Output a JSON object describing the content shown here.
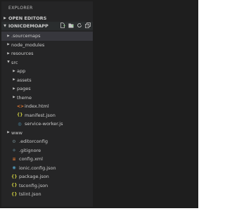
{
  "explorer": {
    "title": "EXPLORER",
    "open_editors": {
      "chevron": "▶",
      "label": "OPEN EDITORS"
    },
    "project": {
      "chevron": "▼",
      "label": "IONICDEMOAPP",
      "actions": [
        "new-file-icon",
        "new-folder-icon",
        "refresh-icon",
        "collapse-all-icon"
      ]
    }
  },
  "tree": [
    {
      "label": ".sourcemaps",
      "type": "folder",
      "expanded": false,
      "depth": 0,
      "selected": true,
      "arrow": "▶"
    },
    {
      "label": "node_modules",
      "type": "folder",
      "expanded": false,
      "depth": 0,
      "arrow": "▶"
    },
    {
      "label": "resources",
      "type": "folder",
      "expanded": false,
      "depth": 0,
      "arrow": "▶"
    },
    {
      "label": "src",
      "type": "folder",
      "expanded": true,
      "depth": 0,
      "arrow": "▼"
    },
    {
      "label": "app",
      "type": "folder",
      "expanded": false,
      "depth": 1,
      "arrow": "▶"
    },
    {
      "label": "assets",
      "type": "folder",
      "expanded": false,
      "depth": 1,
      "arrow": "▶"
    },
    {
      "label": "pages",
      "type": "folder",
      "expanded": false,
      "depth": 1,
      "arrow": "▶"
    },
    {
      "label": "theme",
      "type": "folder",
      "expanded": false,
      "depth": 1,
      "arrow": "▶"
    },
    {
      "label": "index.html",
      "type": "file",
      "icon": "html-file-icon",
      "glyph": "<>",
      "depth": 1
    },
    {
      "label": "manifest.json",
      "type": "file",
      "icon": "json-file-icon",
      "glyph": "{}",
      "depth": 1
    },
    {
      "label": "service-worker.js",
      "type": "file",
      "icon": "js-file-icon",
      "glyph": "◎",
      "depth": 1
    },
    {
      "label": "www",
      "type": "folder",
      "expanded": false,
      "depth": 0,
      "arrow": "▶"
    },
    {
      "label": ".editorconfig",
      "type": "file",
      "icon": "config-file-icon",
      "glyph": "⚙",
      "depth": 0
    },
    {
      "label": ".gitignore",
      "type": "file",
      "icon": "git-file-icon",
      "glyph": "◆",
      "depth": 0
    },
    {
      "label": "config.xml",
      "type": "file",
      "icon": "xml-file-icon",
      "glyph": "≡",
      "depth": 0
    },
    {
      "label": "ionic.config.json",
      "type": "file",
      "icon": "ionic-file-icon",
      "glyph": "◉",
      "depth": 0
    },
    {
      "label": "package.json",
      "type": "file",
      "icon": "json-file-icon",
      "glyph": "{}",
      "depth": 0
    },
    {
      "label": "tsconfig.json",
      "type": "file",
      "icon": "json-file-icon",
      "glyph": "{}",
      "depth": 0
    },
    {
      "label": "tslint.json",
      "type": "file",
      "icon": "json-file-icon",
      "glyph": "{}",
      "depth": 0
    }
  ],
  "colors": {
    "sidebar_bg": "#252526",
    "editor_bg": "#1e1e1e",
    "selected_row": "#37373d",
    "text": "#cccccc"
  }
}
